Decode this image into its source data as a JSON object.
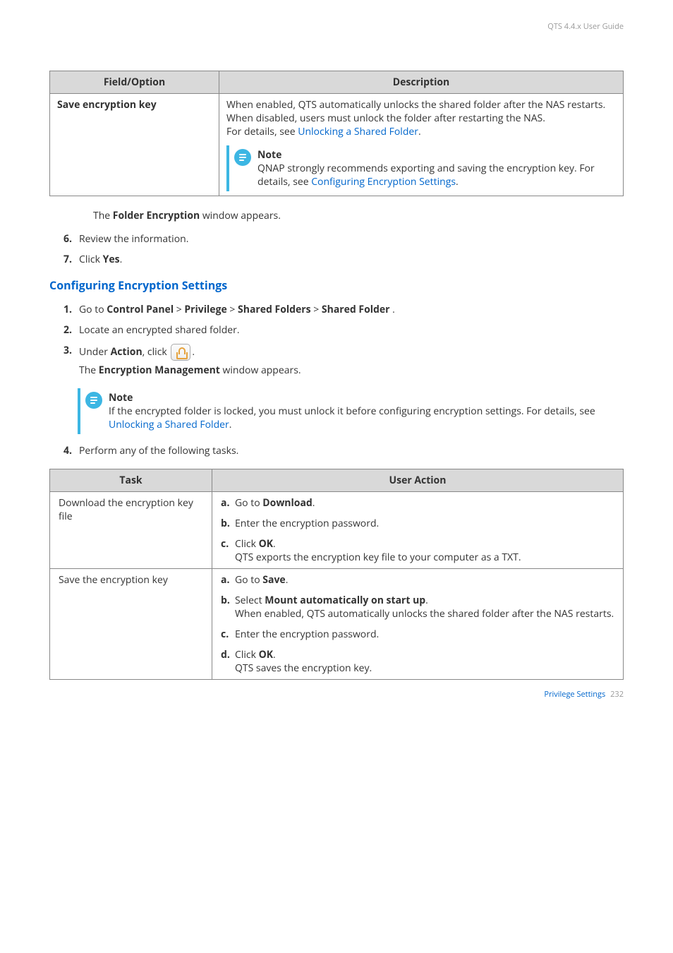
{
  "header": {
    "guide_title": "QTS 4.4.x User Guide"
  },
  "table1": {
    "headers": {
      "field": "Field/Option",
      "description": "Description"
    },
    "row": {
      "field": "Save encryption key",
      "desc_part1": "When enabled, QTS automatically unlocks the shared folder after the NAS restarts.",
      "desc_part2": "When disabled, users must unlock the folder after restarting the NAS.",
      "desc_part3a": "For details, see ",
      "desc_part3_link": "Unlocking a Shared Folder",
      "desc_part3b": ".",
      "note_title": "Note",
      "note_body_a": "QNAP strongly recommends exporting and saving the encryption key. For details, see ",
      "note_body_link": "Configuring Encryption Settings",
      "note_body_b": "."
    }
  },
  "after_table1_text_a": "The ",
  "after_table1_text_bold": "Folder Encryption",
  "after_table1_text_b": " window appears.",
  "step6": {
    "num": "6.",
    "text": "Review the information."
  },
  "step7": {
    "num": "7.",
    "text_a": "Click ",
    "text_bold": "Yes",
    "text_b": "."
  },
  "section_heading": "Configuring Encryption Settings",
  "steps2": {
    "s1": {
      "num": "1.",
      "a": "Go to ",
      "b1": "Control Panel",
      "g1": " > ",
      "b2": "Privilege",
      "g2": " > ",
      "b3": "Shared Folders",
      "g3": " > ",
      "b4": "Shared Folder",
      "end": " ."
    },
    "s2": {
      "num": "2.",
      "text": "Locate an encrypted shared folder."
    },
    "s3": {
      "num": "3.",
      "line1a": "Under ",
      "line1bold": "Action",
      "line1b": ", click ",
      "line1c": ".",
      "line2a": "The ",
      "line2bold": "Encryption Management",
      "line2b": " window appears."
    }
  },
  "note2": {
    "title": "Note",
    "body_a": "If the encrypted folder is locked, you must unlock it before configuring encryption settings. For details, see ",
    "body_link": "Unlocking a Shared Folder",
    "body_b": "."
  },
  "step4": {
    "num": "4.",
    "text": "Perform any of the following tasks."
  },
  "table2": {
    "headers": {
      "task": "Task",
      "action": "User Action"
    },
    "row1": {
      "task": "Download the encryption key file",
      "a": {
        "letter": "a.",
        "pre": "Go to ",
        "bold": "Download",
        "post": "."
      },
      "b": {
        "letter": "b.",
        "text": "Enter the encryption password."
      },
      "c": {
        "letter": "c.",
        "pre": "Click ",
        "bold": "OK",
        "post": ".",
        "sub": "QTS exports the encryption key file to your computer as a TXT."
      }
    },
    "row2": {
      "task": "Save the encryption key",
      "a": {
        "letter": "a.",
        "pre": "Go to ",
        "bold": "Save",
        "post": "."
      },
      "b": {
        "letter": "b.",
        "pre": "Select ",
        "bold": "Mount automatically on start up",
        "post": ".",
        "sub": "When enabled, QTS automatically unlocks the shared folder after the NAS restarts."
      },
      "c": {
        "letter": "c.",
        "text": "Enter the encryption password."
      },
      "d": {
        "letter": "d.",
        "pre": "Click ",
        "bold": "OK",
        "post": ".",
        "sub": "QTS saves the encryption key."
      }
    }
  },
  "footer": {
    "section": "Privilege Settings",
    "page": "232"
  }
}
